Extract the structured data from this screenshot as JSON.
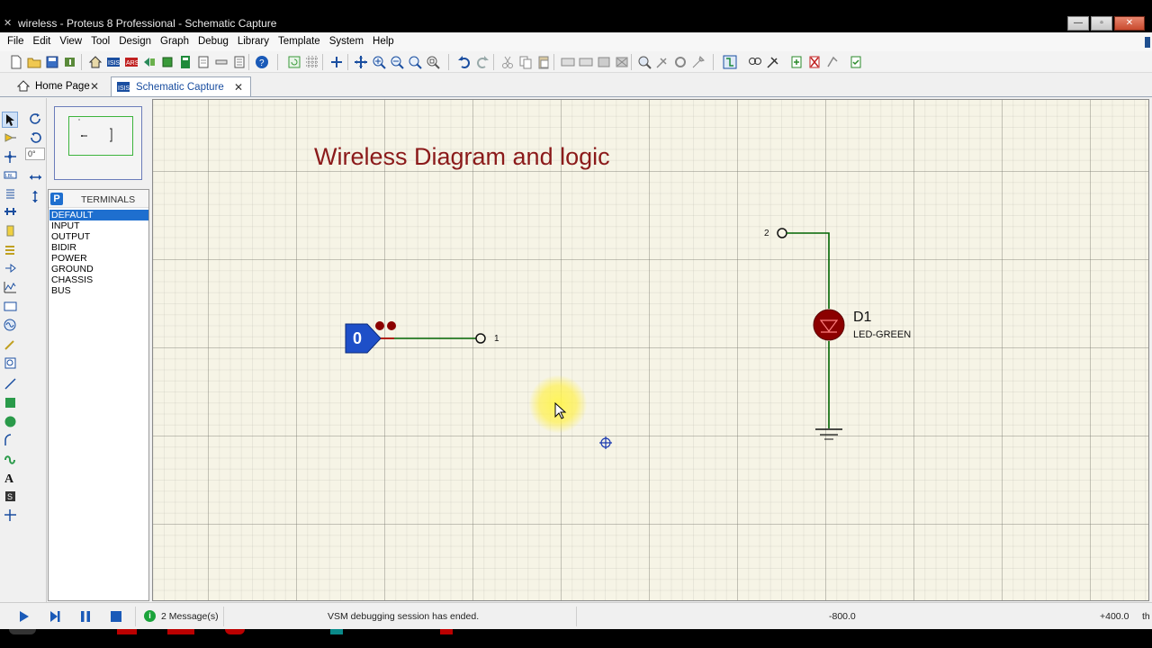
{
  "window": {
    "title": "wireless - Proteus 8 Professional - Schematic Capture",
    "min_icon": "minimize-icon",
    "max_icon": "maximize-icon",
    "close_icon": "close-icon"
  },
  "menu": [
    "File",
    "Edit",
    "View",
    "Tool",
    "Design",
    "Graph",
    "Debug",
    "Library",
    "Template",
    "System",
    "Help"
  ],
  "tabs": [
    {
      "label": "Home Page",
      "icon": "home-icon",
      "active": false
    },
    {
      "label": "Schematic Capture",
      "icon": "isis-icon",
      "active": true
    }
  ],
  "left_tools": {
    "angle_value": "0°"
  },
  "device_panel": {
    "mode_button": "P",
    "title": "TERMINALS",
    "items": [
      "DEFAULT",
      "INPUT",
      "OUTPUT",
      "BIDIR",
      "POWER",
      "GROUND",
      "CHASSIS",
      "BUS"
    ],
    "selected": "DEFAULT"
  },
  "schematic": {
    "title": "Wireless Diagram and logic",
    "logic_state_value": "0",
    "pin1_label": "1",
    "pin2_label": "2",
    "led_ref": "D1",
    "led_value": "LED-GREEN"
  },
  "status": {
    "messages": "2 Message(s)",
    "message": "VSM debugging session has ended.",
    "coord_x": "-800.0",
    "coord_y": "+400.0",
    "units": "th"
  },
  "colors": {
    "title_text": "#8b1a1a",
    "wire": "#006400",
    "logic_probe": "#1e4fc8",
    "led_body": "#8b0000",
    "canvas_bg": "#f6f4e6"
  }
}
